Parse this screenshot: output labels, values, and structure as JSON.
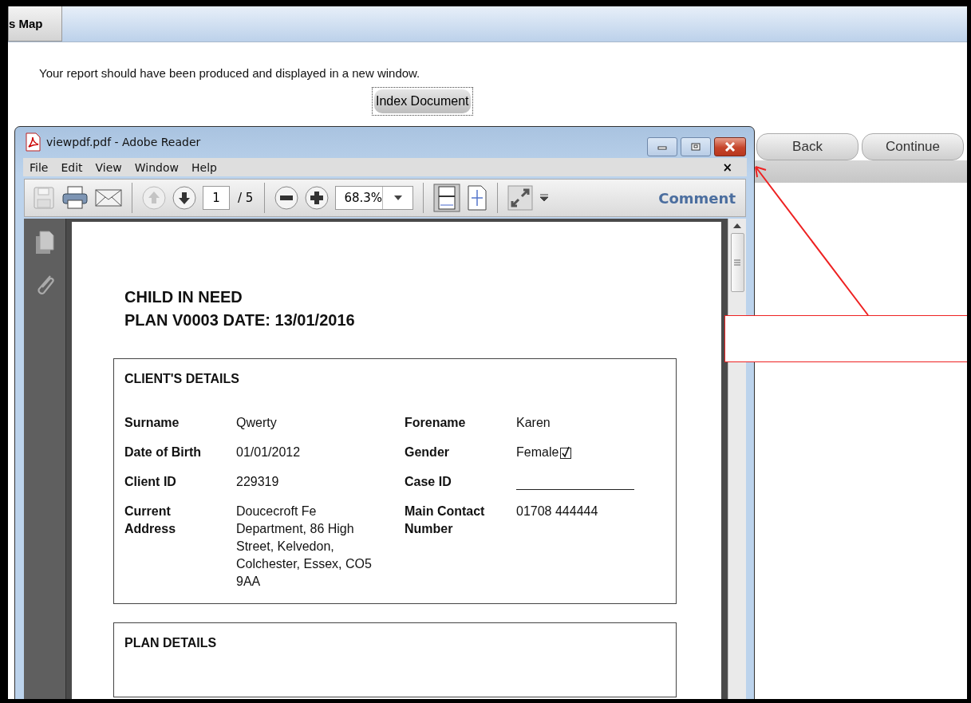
{
  "tab": {
    "label": "s Map"
  },
  "message": "Your report should have been produced and displayed in a new window.",
  "index_button": "Index Document",
  "nav_buttons": [
    "Back",
    "Continue"
  ],
  "reader": {
    "title": "viewpdf.pdf - Adobe Reader",
    "menu": [
      "File",
      "Edit",
      "View",
      "Window",
      "Help"
    ],
    "menu_close": "×",
    "toolbar": {
      "page": "1",
      "page_count": "/ 5",
      "zoom": "68.3%",
      "comment": "Comment"
    },
    "document": {
      "title_lines": [
        "CHILD IN NEED",
        "PLAN V0003 DATE:  13/01/2016"
      ],
      "sections": [
        {
          "heading": "CLIENT'S DETAILS",
          "rows": [
            {
              "label": "Surname",
              "value": "Qwerty",
              "label_2": "Forename",
              "kind": "text",
              "value_2": "Karen"
            },
            {
              "label": "Date of Birth",
              "value": "01/01/2012",
              "label_2": "Gender",
              "kind": "checkbox",
              "value_2": "Female",
              "checked": true
            },
            {
              "label": "Client ID",
              "value": "229319",
              "label_2": "Case ID",
              "kind": "blank"
            },
            {
              "label": "Current Address",
              "value": "Doucecroft Fe Department, 86 High Street, Kelvedon, Colchester, Essex, CO5 9AA",
              "label_2": "Main Contact Number",
              "kind": "text",
              "value_2": "01708 444444"
            }
          ]
        },
        {
          "heading": "PLAN DETAILS"
        }
      ]
    }
  }
}
